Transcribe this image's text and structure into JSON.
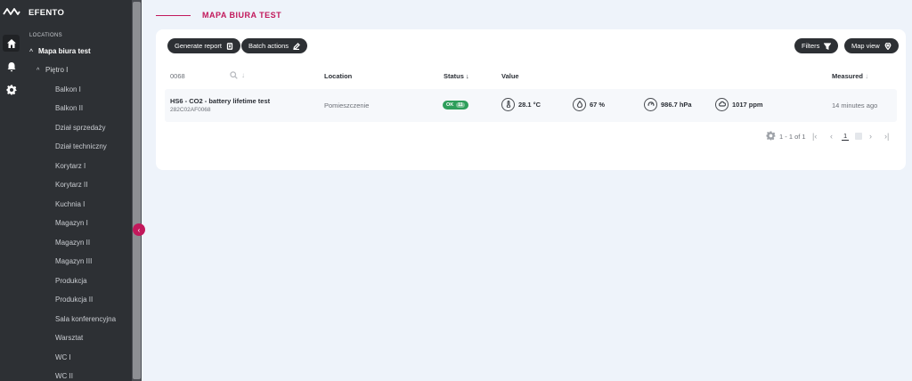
{
  "app": {
    "brand": "EFENTO"
  },
  "sidebar": {
    "section_label": "LOCATIONS",
    "root": {
      "label": "Mapa biura test",
      "chevron": "^"
    },
    "floor": {
      "label": "Piętro I",
      "chevron": "^"
    },
    "items": [
      "Balkon I",
      "Balkon II",
      "Dział sprzedaży",
      "Dział techniczny",
      "Korytarz I",
      "Korytarz II",
      "Kuchnia I",
      "Magazyn I",
      "Magazyn II",
      "Magazyn III",
      "Produkcja",
      "Produkcja II",
      "Sala konferencyjna",
      "Warsztat",
      "WC I",
      "WC II"
    ],
    "collapse_glyph": "‹"
  },
  "header": {
    "title": "MAPA BIURA TEST"
  },
  "toolbar": {
    "generate_report": "Generate report",
    "batch_actions": "Batch actions",
    "filters": "Filters",
    "map_view": "Map view"
  },
  "table": {
    "search": {
      "value": "0068",
      "placeholder": ""
    },
    "columns": {
      "location": "Location",
      "status": "Status",
      "value": "Value",
      "measured": "Measured"
    },
    "rows": [
      {
        "name": "HS6 - CO2 - battery lifetime test",
        "id": "282C02AF0068",
        "location": "Pomieszczenie",
        "status": "OK",
        "status_count": "11",
        "temperature": "28.1 °C",
        "humidity": "67 %",
        "pressure": "986.7 hPa",
        "co2": "1017 ppm",
        "measured": "14 minutes ago"
      }
    ]
  },
  "pagination": {
    "range": "1 - 1 of 1",
    "current_page": "1"
  },
  "colors": {
    "accent": "#c2185b",
    "status_ok": "#2e9e5b",
    "sidebar_bg": "#2d3034"
  }
}
